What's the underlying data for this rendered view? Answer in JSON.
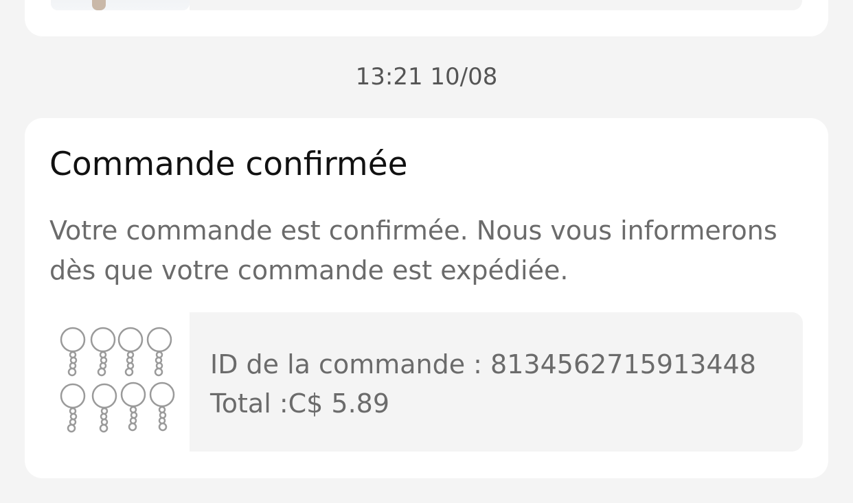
{
  "timestamp": "13:21 10/08",
  "order_card": {
    "title": "Commande confirmée",
    "message": "Votre commande est confirmée. Nous vous informerons dès que votre commande est expédiée.",
    "product_image": "keyring-set-icon",
    "order_id_line": "ID de la commande : 8134562715913448",
    "total_line": "Total :C$ 5.89"
  },
  "previous_card": {
    "product_image": "product-photo"
  }
}
